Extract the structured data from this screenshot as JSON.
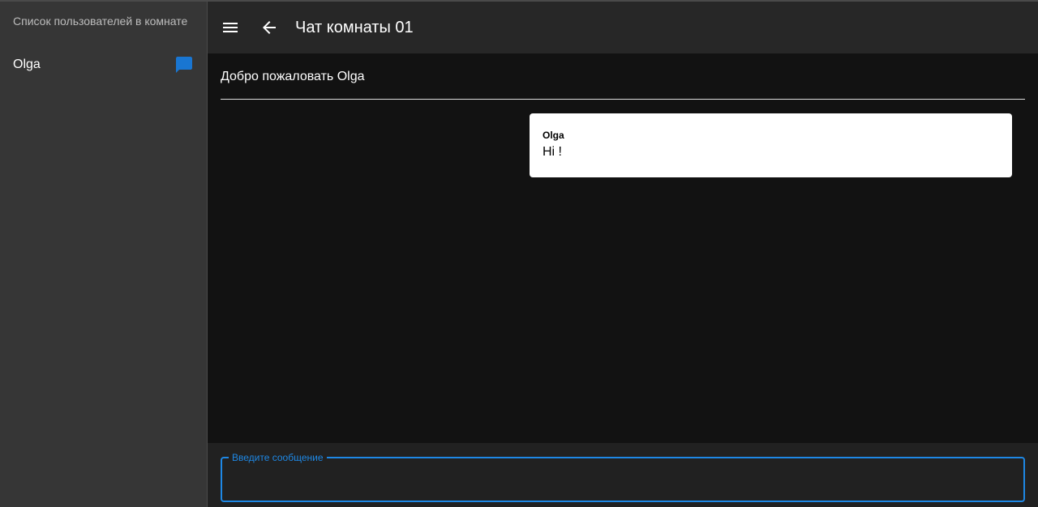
{
  "sidebar": {
    "header": "Список пользователей в комнате",
    "users": [
      {
        "name": "Olga",
        "icon": "chat-bubble-icon",
        "icon_color": "#1976d2"
      }
    ]
  },
  "topbar": {
    "menu_icon": "menu-icon",
    "back_icon": "arrow-back-icon",
    "title": "Чат комнаты 01"
  },
  "main": {
    "welcome": "Добро пожаловать Olga",
    "messages": [
      {
        "author": "Olga",
        "text": "Hi !"
      }
    ]
  },
  "composer": {
    "label": "Введите сообщение",
    "value": "",
    "accent_color": "#1e88e5"
  }
}
